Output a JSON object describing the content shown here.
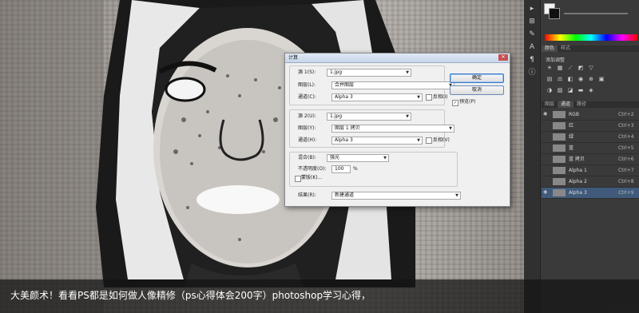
{
  "canvas": {
    "description_icon": "portrait-artwork"
  },
  "panel": {
    "tabs_top": [
      "颜色",
      "样式"
    ],
    "adjust_label": "添加调整",
    "tabs_bottom": [
      "图层",
      "通道",
      "路径"
    ],
    "channels": [
      {
        "name": "RGB",
        "shortcut": "Ctrl+2"
      },
      {
        "name": "红",
        "shortcut": "Ctrl+3"
      },
      {
        "name": "绿",
        "shortcut": "Ctrl+4"
      },
      {
        "name": "蓝",
        "shortcut": "Ctrl+5"
      },
      {
        "name": "蓝 拷贝",
        "shortcut": "Ctrl+6"
      },
      {
        "name": "Alpha 1",
        "shortcut": "Ctrl+7"
      },
      {
        "name": "Alpha 2",
        "shortcut": "Ctrl+8"
      },
      {
        "name": "Alpha 3",
        "shortcut": "Ctrl+9"
      }
    ]
  },
  "dialog": {
    "title": "计算",
    "source1": {
      "label": "源 1(S):",
      "value": "1.jpg",
      "layer_label": "图层(L):",
      "layer_value": "合并图层",
      "channel_label": "通道(C):",
      "channel_value": "Alpha 3",
      "invert_label": "反相(I)"
    },
    "source2": {
      "label": "源 2(U):",
      "value": "1.jpg",
      "layer_label": "图层(Y):",
      "layer_value": "图层 1 拷贝",
      "channel_label": "通道(H):",
      "channel_value": "Alpha 3",
      "invert_label": "反相(V)"
    },
    "blend": {
      "label": "混合(B):",
      "value": "强光",
      "opacity_label": "不透明度(O):",
      "opacity_value": "100",
      "opacity_unit": "%",
      "mask_label": "蒙版(K)..."
    },
    "result": {
      "label": "结果(R):",
      "value": "新建通道"
    },
    "ok_label": "确定",
    "cancel_label": "取消",
    "preview_label": "预览(P)",
    "preview_checked": "✓"
  },
  "caption": "大美颜术！看看PS都是如何做人像精修（ps心得体会200字）photoshop学习心得，"
}
